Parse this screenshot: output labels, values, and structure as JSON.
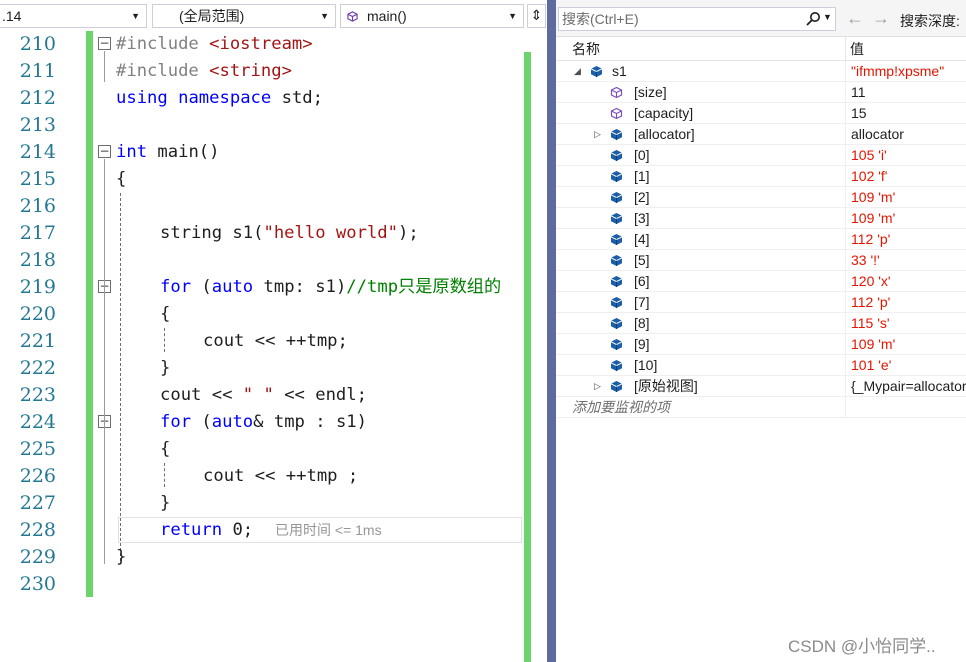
{
  "editor": {
    "project_dropdown": ".14",
    "scope_dropdown": "(全局范围)",
    "function_dropdown": "main()",
    "split_button": "⇕",
    "line_numbers": [
      "210",
      "211",
      "212",
      "213",
      "214",
      "215",
      "216",
      "217",
      "218",
      "219",
      "220",
      "221",
      "222",
      "223",
      "224",
      "225",
      "226",
      "227",
      "228",
      "229",
      "230"
    ],
    "code": {
      "l210_a": "#include ",
      "l210_b": "<iostream>",
      "l211_a": "#include ",
      "l211_b": "<string>",
      "l212_kw1": "using",
      "l212_kw2": "namespace",
      "l212_rest": " std;",
      "l214_kw": "int",
      "l214_rest": " main()",
      "l215": "{",
      "l217_a": "string s1(",
      "l217_str": "\"hello world\"",
      "l217_b": ");",
      "l219_kw": "for",
      "l219_a": " (",
      "l219_kw2": "auto",
      "l219_b": " tmp: s1)",
      "l219_cm": "//tmp只是原数组的",
      "l220": "{",
      "l221": "cout << ++tmp;",
      "l222": "}",
      "l223_a": "cout << ",
      "l223_str": "\" \"",
      "l223_b": " << endl;",
      "l224_kw": "for",
      "l224_a": " (",
      "l224_kw2": "auto",
      "l224_b": "& tmp : s1)",
      "l225": "{",
      "l226": "cout << ++tmp ;",
      "l227": "}",
      "l228_kw": "return",
      "l228_rest": " 0;",
      "l229": "}"
    },
    "perf_tip": "已用时间 <= 1ms"
  },
  "watch": {
    "search_placeholder": "搜索(Ctrl+E)",
    "back_icon": "←",
    "forward_icon": "→",
    "depth_label": "搜索深度:",
    "column_name": "名称",
    "column_value": "值",
    "rows": [
      {
        "name": "s1",
        "value": "\"ifmmp!xpsme\"",
        "expander": "◢",
        "icon": "object-icon",
        "red": true
      },
      {
        "name": "[size]",
        "value": "11",
        "expander": "",
        "icon": "property-icon",
        "red": false
      },
      {
        "name": "[capacity]",
        "value": "15",
        "expander": "",
        "icon": "property-icon",
        "red": false
      },
      {
        "name": "[allocator]",
        "value": "allocator",
        "expander": "▷",
        "icon": "object-icon",
        "red": false
      },
      {
        "name": "[0]",
        "value": "105 'i'",
        "expander": "",
        "icon": "object-icon",
        "red": true
      },
      {
        "name": "[1]",
        "value": "102 'f'",
        "expander": "",
        "icon": "object-icon",
        "red": true
      },
      {
        "name": "[2]",
        "value": "109 'm'",
        "expander": "",
        "icon": "object-icon",
        "red": true
      },
      {
        "name": "[3]",
        "value": "109 'm'",
        "expander": "",
        "icon": "object-icon",
        "red": true
      },
      {
        "name": "[4]",
        "value": "112 'p'",
        "expander": "",
        "icon": "object-icon",
        "red": true
      },
      {
        "name": "[5]",
        "value": "33 '!'",
        "expander": "",
        "icon": "object-icon",
        "red": true
      },
      {
        "name": "[6]",
        "value": "120 'x'",
        "expander": "",
        "icon": "object-icon",
        "red": true
      },
      {
        "name": "[7]",
        "value": "112 'p'",
        "expander": "",
        "icon": "object-icon",
        "red": true
      },
      {
        "name": "[8]",
        "value": "115 's'",
        "expander": "",
        "icon": "object-icon",
        "red": true
      },
      {
        "name": "[9]",
        "value": "109 'm'",
        "expander": "",
        "icon": "object-icon",
        "red": true
      },
      {
        "name": "[10]",
        "value": "101 'e'",
        "expander": "",
        "icon": "object-icon",
        "red": true
      },
      {
        "name": "[原始视图]",
        "value": "{_Mypair=allocator",
        "expander": "▷",
        "icon": "object-icon",
        "red": false
      }
    ],
    "add_watch_placeholder": "添加要监视的项"
  },
  "watermark": "CSDN @小怡同学..",
  "colors": {
    "keyword": "#0000ff",
    "string": "#a31515",
    "comment": "#008000",
    "line_number": "#237893",
    "change_bar": "#6bd56b",
    "value_changed": "#e51400",
    "splitter": "#5f6a9e"
  }
}
